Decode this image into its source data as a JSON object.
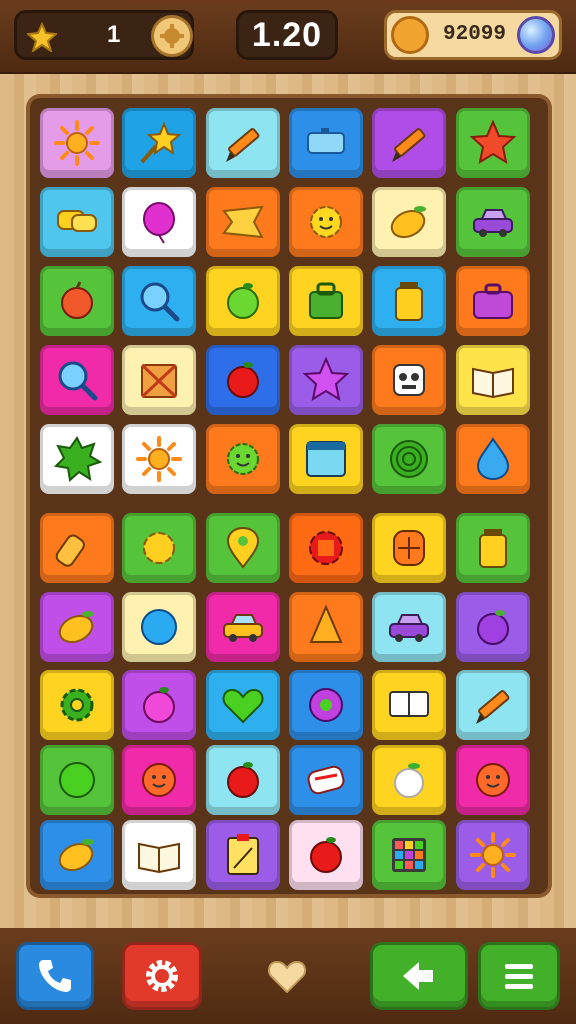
{
  "hud": {
    "stars": "1",
    "timer": "1.20",
    "coins": "92099"
  },
  "colors": {
    "wood_dark": "#4e2a12",
    "board_frame": "#5a3418",
    "call_button": "#2a8ae0",
    "settings_button": "#e23a2a",
    "back_button": "#43b02a",
    "menu_button": "#43b02a"
  },
  "board": {
    "columns": 6,
    "rows": 10,
    "tiles": [
      {
        "color": "#e49be8",
        "icon": "sun"
      },
      {
        "color": "#1fa3e6",
        "icon": "star-wand"
      },
      {
        "color": "#8fe4f2",
        "icon": "pencil"
      },
      {
        "color": "#2e8fe8",
        "icon": "ticket"
      },
      {
        "color": "#b04de6",
        "icon": "pencil"
      },
      {
        "color": "#55c43a",
        "icon": "star"
      },
      {
        "color": "#4fc6ee",
        "icon": "speech-bubbles"
      },
      {
        "color": "#ffffff",
        "icon": "balloon"
      },
      {
        "color": "#ff7a1c",
        "icon": "bow"
      },
      {
        "color": "#ff7a1c",
        "icon": "sun-face"
      },
      {
        "color": "#fff2b0",
        "icon": "lemon"
      },
      {
        "color": "#55c43a",
        "icon": "car"
      },
      {
        "color": "#55c43a",
        "icon": "apple"
      },
      {
        "color": "#2eb0f0",
        "icon": "magnifier"
      },
      {
        "color": "#ffd420",
        "icon": "apple-green"
      },
      {
        "color": "#ffd420",
        "icon": "bag"
      },
      {
        "color": "#2eb0f0",
        "icon": "jar"
      },
      {
        "color": "#ff7a1c",
        "icon": "suitcase"
      },
      {
        "color": "#f02aa8",
        "icon": "magnifier"
      },
      {
        "color": "#fff2b0",
        "icon": "box"
      },
      {
        "color": "#2e6ee8",
        "icon": "apple-red"
      },
      {
        "color": "#9b5de8",
        "icon": "star-purple"
      },
      {
        "color": "#ff7a1c",
        "icon": "robot"
      },
      {
        "color": "#ffe34a",
        "icon": "book"
      },
      {
        "color": "#ffffff",
        "icon": "splat"
      },
      {
        "color": "#ffffff",
        "icon": "sun"
      },
      {
        "color": "#ff7a1c",
        "icon": "sun-face-green"
      },
      {
        "color": "#ffd420",
        "icon": "window"
      },
      {
        "color": "#55c43a",
        "icon": "spiral"
      },
      {
        "color": "#ff7a1c",
        "icon": "drop"
      },
      {
        "color": "#ff7a1c",
        "icon": "bottle"
      },
      {
        "color": "#55c43a",
        "icon": "gear-blob"
      },
      {
        "color": "#55c43a",
        "icon": "pin"
      },
      {
        "color": "#ff6a14",
        "icon": "bracket-blob"
      },
      {
        "color": "#ffd420",
        "icon": "token"
      },
      {
        "color": "#55c43a",
        "icon": "jar"
      },
      {
        "color": "#c04ee8",
        "icon": "lemon"
      },
      {
        "color": "#fff2b0",
        "icon": "ball"
      },
      {
        "color": "#f02aa8",
        "icon": "car-yellow"
      },
      {
        "color": "#ff7a1c",
        "icon": "cone"
      },
      {
        "color": "#8fe4f2",
        "icon": "car"
      },
      {
        "color": "#9b5de8",
        "icon": "plum"
      },
      {
        "color": "#ffd420",
        "icon": "gear"
      },
      {
        "color": "#c04ee8",
        "icon": "apple-pink"
      },
      {
        "color": "#2eb0f0",
        "icon": "heart"
      },
      {
        "color": "#2e8fe8",
        "icon": "donut"
      },
      {
        "color": "#ffd420",
        "icon": "screen"
      },
      {
        "color": "#8fe4f2",
        "icon": "pencil"
      },
      {
        "color": "#55c43a",
        "icon": "ball-green"
      },
      {
        "color": "#f02aa8",
        "icon": "smiley"
      },
      {
        "color": "#8fe4f2",
        "icon": "apple-red"
      },
      {
        "color": "#2e8fe8",
        "icon": "scroll"
      },
      {
        "color": "#ffd420",
        "icon": "apple-white"
      },
      {
        "color": "#f02aa8",
        "icon": "smiley"
      },
      {
        "color": "#2e8fe8",
        "icon": "lemon"
      },
      {
        "color": "#ffffff",
        "icon": "book"
      },
      {
        "color": "#9b5de8",
        "icon": "clipboard"
      },
      {
        "color": "#ffe0f0",
        "icon": "apple-red"
      },
      {
        "color": "#55c43a",
        "icon": "grid"
      },
      {
        "color": "#9b5de8",
        "icon": "sun"
      }
    ]
  },
  "toolbar": {
    "call": "phone-icon",
    "settings": "gear-icon",
    "favorite": "heart-icon",
    "back": "arrow-left-icon",
    "menu": "menu-icon"
  }
}
